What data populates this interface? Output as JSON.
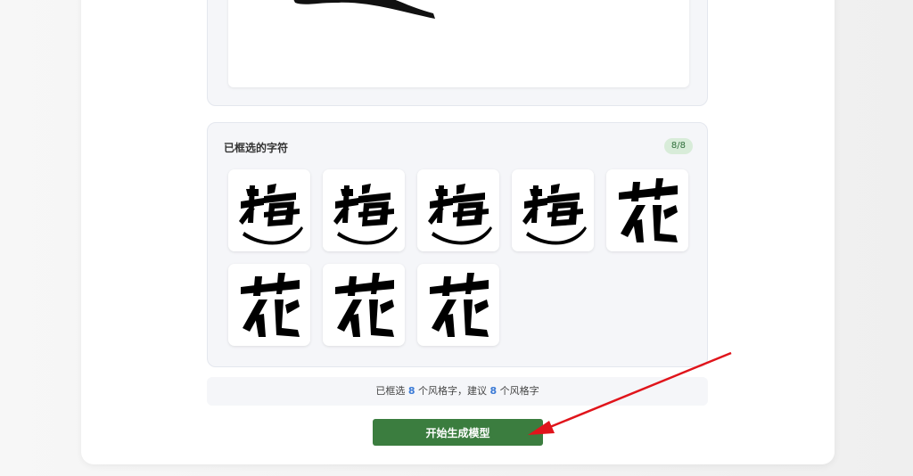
{
  "selected_panel": {
    "title": "已框选的字符",
    "count_badge": "8/8",
    "glyphs": [
      {
        "char": "梅"
      },
      {
        "char": "梅"
      },
      {
        "char": "梅"
      },
      {
        "char": "梅"
      },
      {
        "char": "花"
      },
      {
        "char": "花"
      },
      {
        "char": "花"
      },
      {
        "char": "花"
      }
    ]
  },
  "summary": {
    "part1": "已框选 ",
    "selected_count": "8",
    "part2": " 个风格字，建议 ",
    "suggested_count": "8",
    "part3": " 个风格字"
  },
  "actions": {
    "start_label": "开始生成模型"
  },
  "colors": {
    "accent_green": "#3b7d3f",
    "count_blue": "#3c7bd6",
    "annotation_red": "#e0141b"
  }
}
